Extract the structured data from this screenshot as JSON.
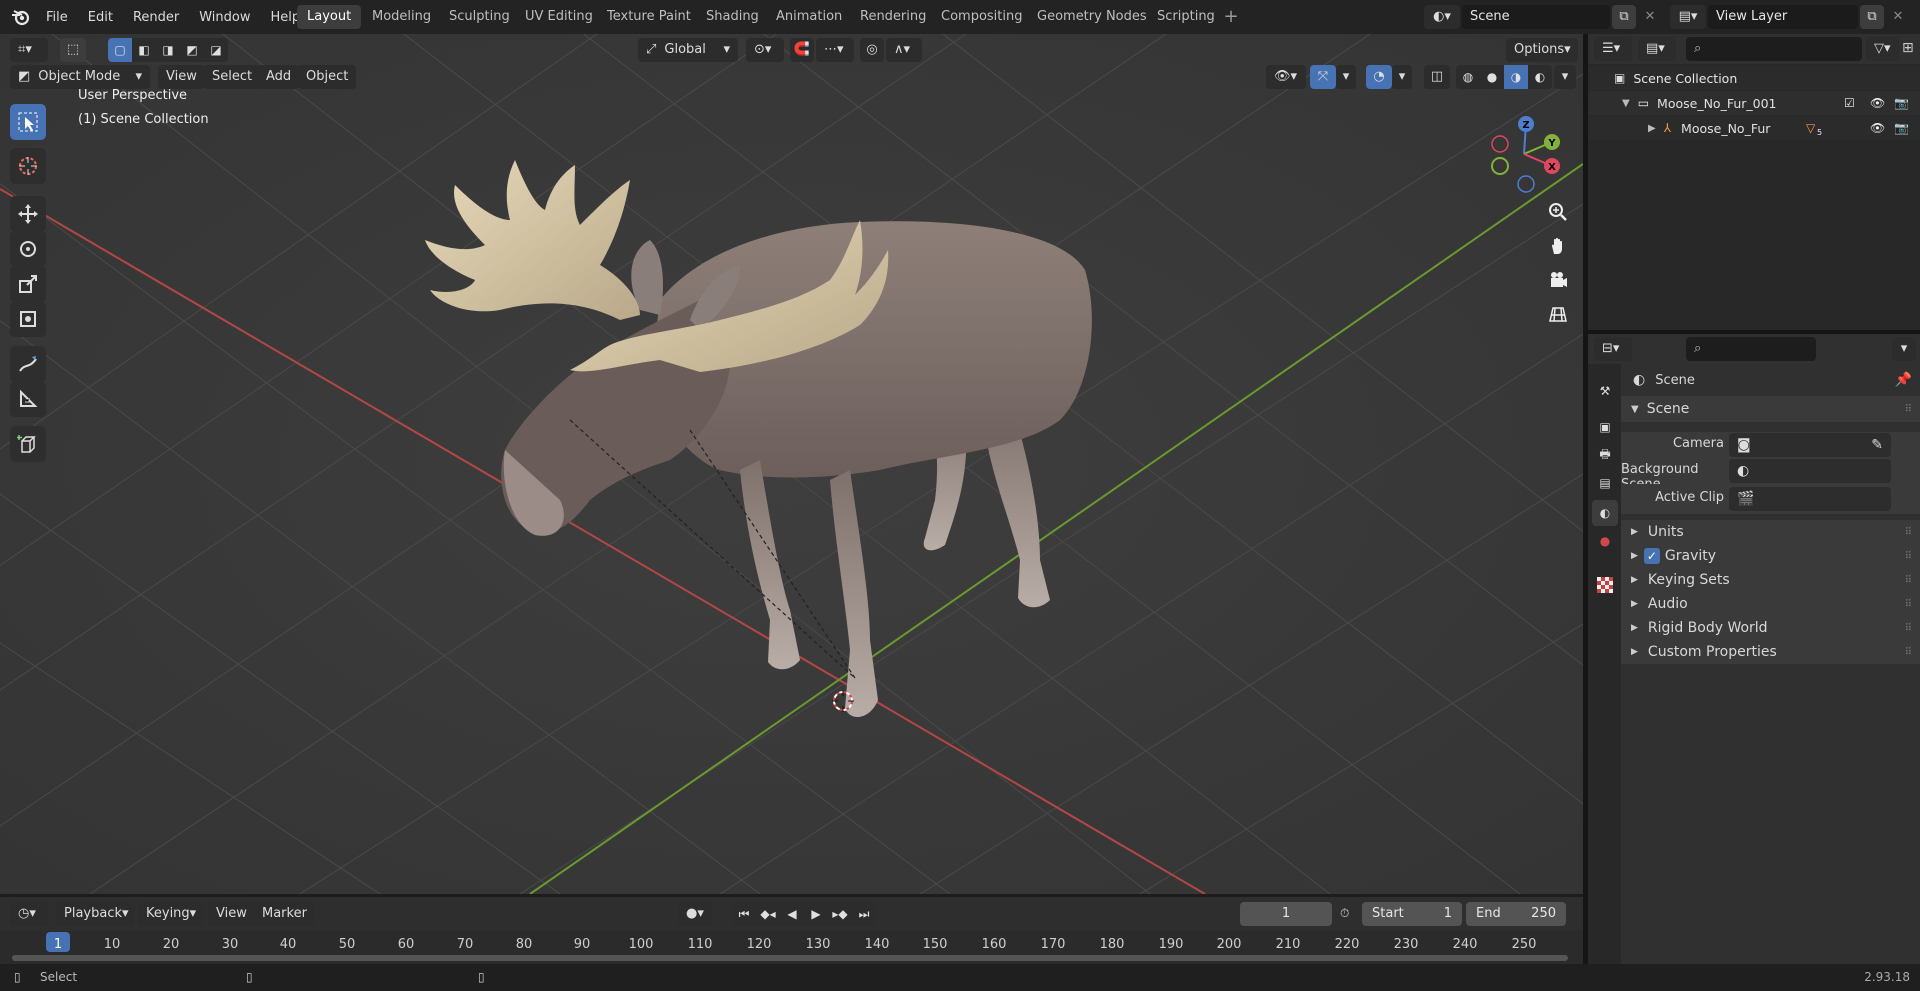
{
  "menu": [
    "File",
    "Edit",
    "Render",
    "Window",
    "Help"
  ],
  "workspaces": [
    "Layout",
    "Modeling",
    "Sculpting",
    "UV Editing",
    "Texture Paint",
    "Shading",
    "Animation",
    "Rendering",
    "Compositing",
    "Geometry Nodes",
    "Scripting"
  ],
  "active_workspace": "Layout",
  "scene_field": "Scene",
  "view_layer_field": "View Layer",
  "viewport": {
    "mode": "Object Mode",
    "header_menus": [
      "View",
      "Select",
      "Add",
      "Object"
    ],
    "transform_orientation": "Global",
    "options_label": "Options",
    "overlay_title": "User Perspective",
    "overlay_collection": "(1) Scene Collection",
    "gizmo_labels": {
      "z": "Z",
      "y": "Y",
      "x": "X"
    }
  },
  "outliner": {
    "root": "Scene Collection",
    "items": [
      {
        "name": "Moose_No_Fur_001",
        "type": "collection"
      },
      {
        "name": "Moose_No_Fur",
        "type": "object",
        "badge": "5"
      }
    ]
  },
  "properties": {
    "context_title": "Scene",
    "panel_title": "Scene",
    "fields": [
      {
        "label": "Camera"
      },
      {
        "label": "Background Scene"
      },
      {
        "label": "Active Clip"
      }
    ],
    "sections": [
      "Units",
      "Gravity",
      "Keying Sets",
      "Audio",
      "Rigid Body World",
      "Custom Properties"
    ],
    "gravity_checked": true
  },
  "timeline": {
    "menus": [
      "Playback",
      "Keying",
      "View",
      "Marker"
    ],
    "current_frame": "1",
    "start_label": "Start",
    "start_value": "1",
    "end_label": "End",
    "end_value": "250",
    "ruler": [
      "1",
      "10",
      "20",
      "30",
      "40",
      "50",
      "60",
      "70",
      "80",
      "90",
      "100",
      "110",
      "120",
      "130",
      "140",
      "150",
      "160",
      "170",
      "180",
      "190",
      "200",
      "210",
      "220",
      "230",
      "240",
      "250"
    ]
  },
  "status": {
    "left": "Select",
    "version": "2.93.18"
  },
  "colors": {
    "accent": "#4772b3",
    "x_axis": "#b34747",
    "y_axis": "#6a9a2e",
    "viewport_bg": "#393939"
  }
}
